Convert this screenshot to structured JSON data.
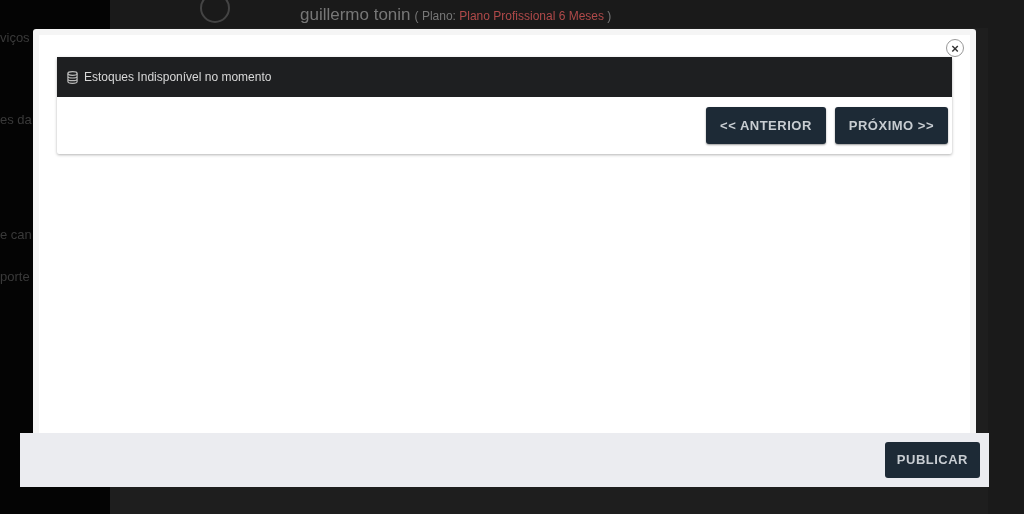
{
  "background": {
    "user_name": "guillermo tonin",
    "plan_prefix": "( Plano:",
    "plan_name": "Plano Profissional 6 Meses",
    "plan_suffix": ")",
    "sidebar_items": [
      "viços",
      "es da",
      "e can",
      "porte"
    ]
  },
  "modal": {
    "notice": "Estoques Indisponível no momento",
    "close": "×",
    "nav_buttons": [
      "<< ANTERIOR",
      "PRÓXIMO >>"
    ],
    "footer_button": "PUBLICAR"
  }
}
